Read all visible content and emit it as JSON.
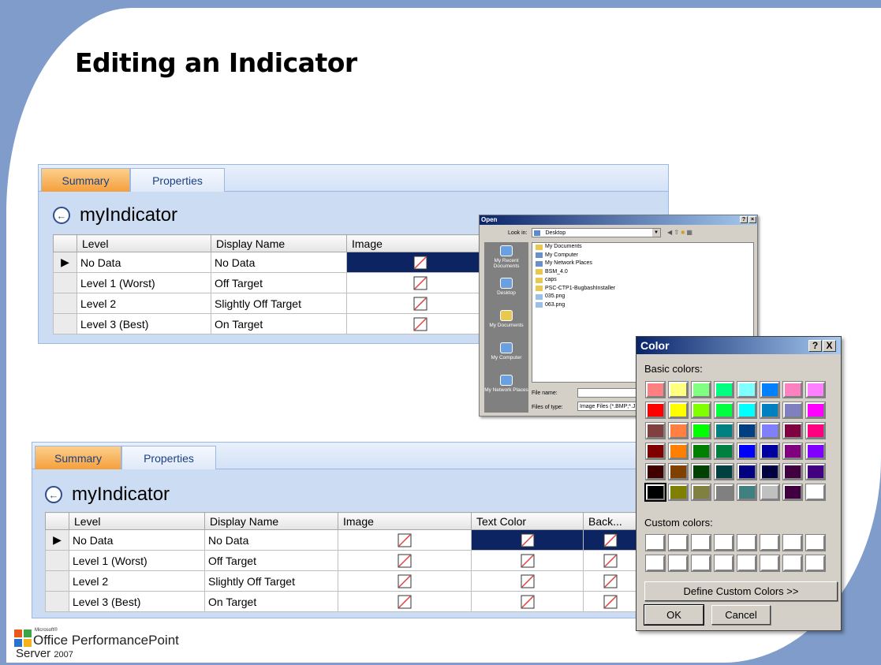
{
  "slide": {
    "title": "Editing an Indicator"
  },
  "top_panel": {
    "tabs": [
      "Summary",
      "Properties"
    ],
    "indicator_name": "myIndicator",
    "columns": [
      "Level",
      "Display Name",
      "Image"
    ],
    "rows": [
      {
        "level": "No Data",
        "display": "No Data"
      },
      {
        "level": "Level 1 (Worst)",
        "display": "Off Target"
      },
      {
        "level": "Level 2",
        "display": "Slightly Off Target"
      },
      {
        "level": "Level 3 (Best)",
        "display": "On Target"
      }
    ]
  },
  "bottom_panel": {
    "tabs": [
      "Summary",
      "Properties"
    ],
    "indicator_name": "myIndicator",
    "columns": [
      "Level",
      "Display Name",
      "Image",
      "Text Color",
      "Back..."
    ],
    "rows": [
      {
        "level": "No Data",
        "display": "No Data"
      },
      {
        "level": "Level 1 (Worst)",
        "display": "Off Target"
      },
      {
        "level": "Level 2",
        "display": "Slightly Off Target"
      },
      {
        "level": "Level 3 (Best)",
        "display": "On Target"
      }
    ]
  },
  "open_dialog": {
    "title": "Open",
    "look_in_label": "Look in:",
    "look_in_value": "Desktop",
    "places": [
      "My Recent Documents",
      "Desktop",
      "My Documents",
      "My Computer",
      "My Network Places"
    ],
    "files": [
      "My Documents",
      "My Computer",
      "My Network Places",
      "BSM_4.0",
      "caps",
      "PSC-CTP1-BugbashInstaller",
      "035.png",
      "063.png"
    ],
    "file_name_label": "File name:",
    "files_of_type_label": "Files of type:",
    "files_of_type_value": "Image Files (*.BMP;*.JPG"
  },
  "color_dialog": {
    "title": "Color",
    "help_btn": "?",
    "close_btn": "X",
    "basic_label": "Basic colors:",
    "custom_label": "Custom colors:",
    "define_btn": "Define Custom Colors >>",
    "ok_btn": "OK",
    "cancel_btn": "Cancel",
    "basic_colors": [
      "#ff8080",
      "#ffff80",
      "#80ff80",
      "#00ff80",
      "#80ffff",
      "#0080ff",
      "#ff80c0",
      "#ff80ff",
      "#ff0000",
      "#ffff00",
      "#80ff00",
      "#00ff40",
      "#00ffff",
      "#0080c0",
      "#8080c0",
      "#ff00ff",
      "#804040",
      "#ff8040",
      "#00ff00",
      "#008080",
      "#004080",
      "#8080ff",
      "#800040",
      "#ff0080",
      "#800000",
      "#ff8000",
      "#008000",
      "#008040",
      "#0000ff",
      "#0000a0",
      "#800080",
      "#8000ff",
      "#400000",
      "#804000",
      "#004000",
      "#004040",
      "#000080",
      "#000040",
      "#400040",
      "#400080",
      "#000000",
      "#808000",
      "#808040",
      "#808080",
      "#408080",
      "#c0c0c0",
      "#400040",
      "#ffffff"
    ],
    "selected_index": 40
  },
  "logo": {
    "microsoft": "Microsoft®",
    "office": "Office PerformancePoint",
    "server": "Server",
    "year": "2007"
  }
}
